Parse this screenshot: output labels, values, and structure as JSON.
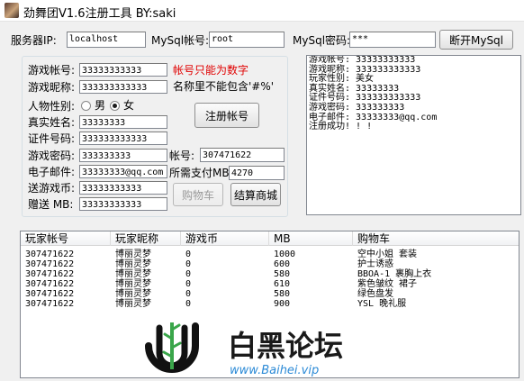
{
  "window": {
    "title": "劲舞团V1.6注册工具 BY:saki"
  },
  "server": {
    "server_ip_label": "服务器IP:",
    "server_ip_value": "localhost",
    "mysql_account_label": "MySql帐号:",
    "mysql_account_value": "root",
    "mysql_password_label": "MySql密码:",
    "mysql_password_value": "***",
    "disconnect_button": "断开MySql"
  },
  "register": {
    "game_account_label": "游戏帐号:",
    "game_account_value": "33333333333",
    "nickname_label": "游戏昵称:",
    "nickname_value": "333333333333",
    "gender_label": "人物性别:",
    "gender_male": "男",
    "gender_female": "女",
    "real_name_label": "真实姓名:",
    "real_name_value": "33333333",
    "id_number_label": "证件号码:",
    "id_number_value": "333333333333",
    "game_password_label": "游戏密码:",
    "game_password_value": "333333333",
    "email_label": "电子邮件:",
    "email_value": "33333333@qq.com",
    "send_coin_label": "送游戏币:",
    "send_coin_value": "33333333333",
    "gift_mb_label": "赠送 MB:",
    "gift_mb_value": "33333333333",
    "hint_numbers_only": "帐号只能为数字",
    "hint_no_chars": "名称里不能包含'#%'",
    "register_button": "注册帐号",
    "account_label": "帐号:",
    "account_value": "307471622",
    "pay_mb_label": "所需支付MB:",
    "pay_mb_value": "4270",
    "cart_button": "购物车",
    "checkout_button": "结算商城"
  },
  "log": {
    "lines": [
      "游戏帐号: 33333333333",
      "游戏昵称: 333333333333",
      "玩家性别: 美女",
      "真实姓名: 33333333",
      "证件号码: 333333333333",
      "游戏密码: 333333333",
      "电子邮件: 33333333@qq.com",
      "注册成功! ! !"
    ]
  },
  "table": {
    "headers": [
      "玩家帐号",
      "玩家昵称",
      "游戏币",
      "MB",
      "购物车"
    ],
    "rows": [
      [
        "307471622",
        "博丽灵梦",
        "0",
        "1000",
        "空中小姐 套装"
      ],
      [
        "307471622",
        "博丽灵梦",
        "0",
        "600",
        "护士诱惑"
      ],
      [
        "307471622",
        "博丽灵梦",
        "0",
        "580",
        "BBOA-1 裹胸上衣"
      ],
      [
        "307471622",
        "博丽灵梦",
        "0",
        "610",
        "紫色皱纹 裙子"
      ],
      [
        "307471622",
        "博丽灵梦",
        "0",
        "580",
        "绿色盘发"
      ],
      [
        "307471622",
        "博丽灵梦",
        "0",
        "900",
        "YSL 晚礼服"
      ]
    ]
  },
  "watermark": {
    "name": "白黑论坛",
    "url": "www.Baihei.vip"
  }
}
